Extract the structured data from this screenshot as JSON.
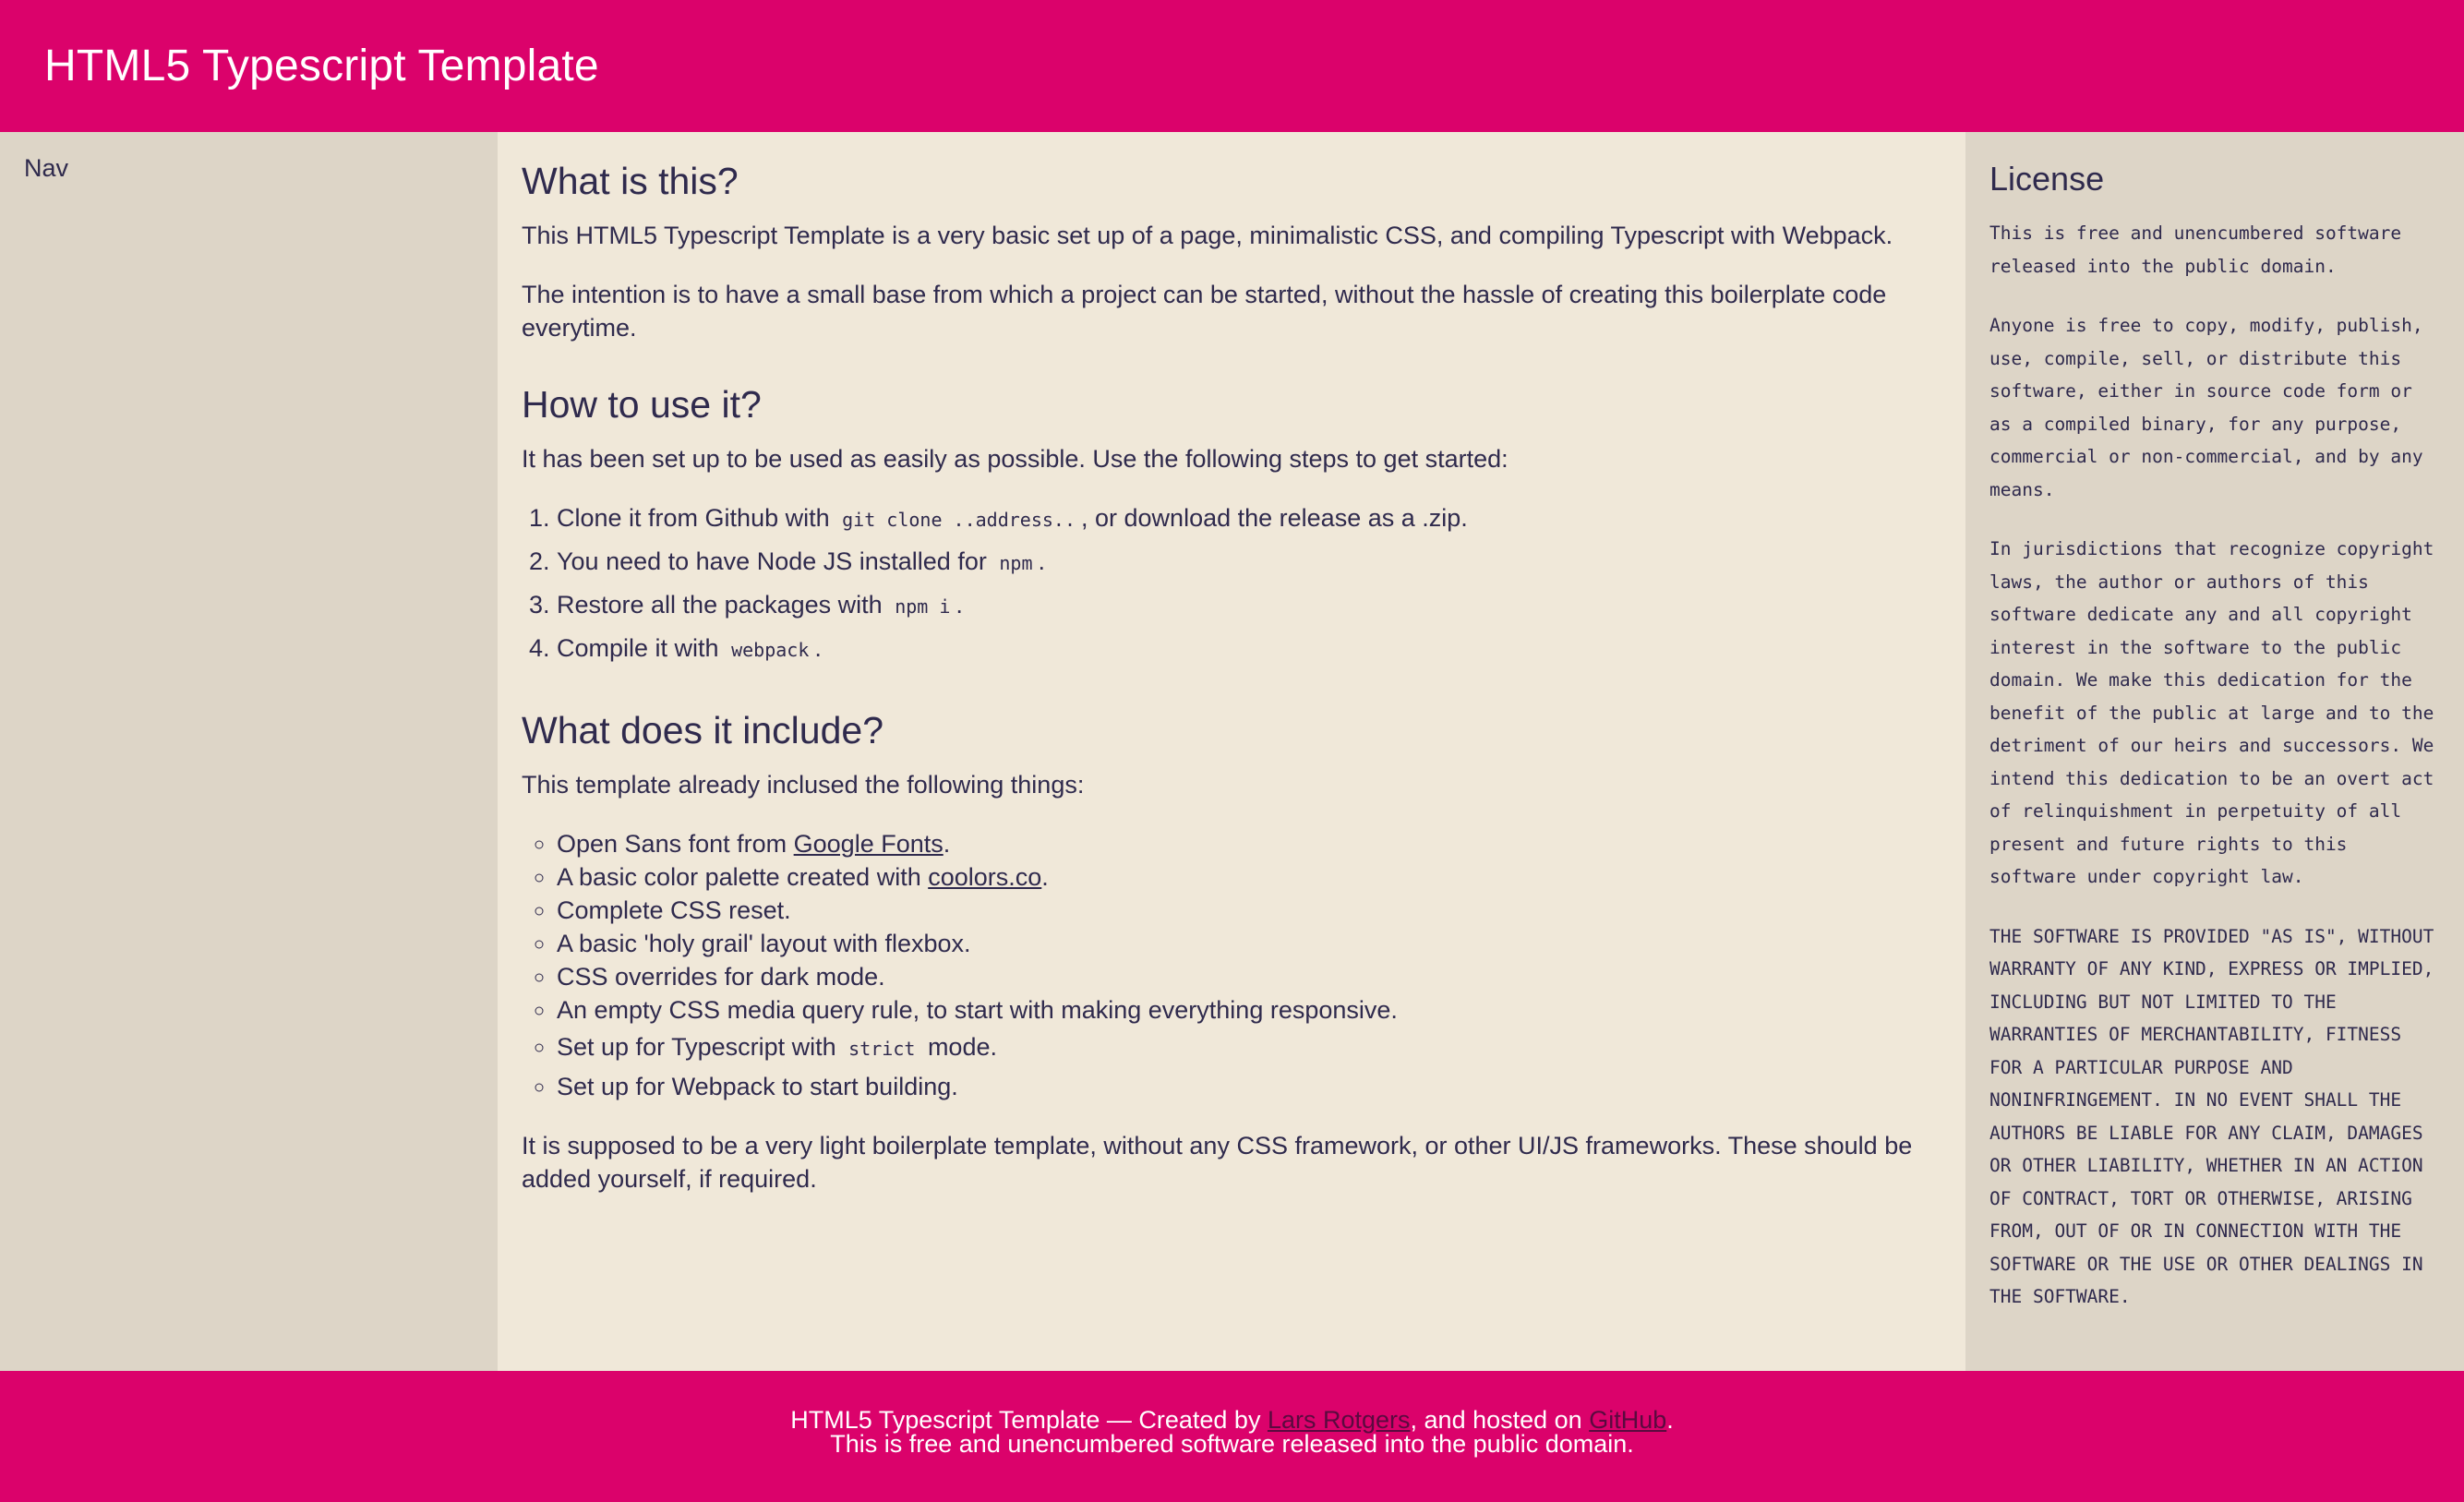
{
  "colors": {
    "brand": "#db026b",
    "background": "#f0e8d9",
    "sidebar": "#ddd5c7",
    "text": "#2f2a4d"
  },
  "header": {
    "title": "HTML5 Typescript Template"
  },
  "nav": {
    "label": "Nav"
  },
  "main": {
    "what": {
      "heading": "What is this?",
      "p1": "This HTML5 Typescript Template is a very basic set up of a page, minimalistic CSS, and compiling Typescript with Webpack.",
      "p2": "The intention is to have a small base from which a project can be started, without the hassle of creating this boilerplate code everytime."
    },
    "how": {
      "heading": "How to use it?",
      "intro": "It has been set up to be used as easily as possible. Use the following steps to get started:",
      "steps": [
        {
          "before": "Clone it from Github with",
          "code": "git clone ..address..",
          "after": ", or download the release as a .zip."
        },
        {
          "before": "You need to have Node JS installed for",
          "code": "npm",
          "after": "."
        },
        {
          "before": "Restore all the packages with",
          "code": "npm i",
          "after": "."
        },
        {
          "before": "Compile it with",
          "code": "webpack",
          "after": "."
        }
      ]
    },
    "include": {
      "heading": "What does it include?",
      "intro": "This template already inclused the following things:",
      "items": {
        "fonts": {
          "before": "Open Sans font from ",
          "link": "Google Fonts",
          "after": "."
        },
        "palette": {
          "before": "A basic color palette created with ",
          "link": "coolors.co",
          "after": "."
        },
        "reset": "Complete CSS reset.",
        "layout": "A basic 'holy grail' layout with flexbox.",
        "dark": "CSS overrides for dark mode.",
        "media": "An empty CSS media query rule, to start with making everything responsive.",
        "typescript": {
          "before": "Set up for Typescript with",
          "code": "strict",
          "after": "mode."
        },
        "webpack": "Set up for Webpack to start building."
      },
      "outro": "It is supposed to be a very light boilerplate template, without any CSS framework, or other UI/JS frameworks. These should be added yourself, if required."
    }
  },
  "license": {
    "heading": "License",
    "paragraphs": [
      "This is free and unencumbered software released into the public domain.",
      "Anyone is free to copy, modify, publish, use, compile, sell, or distribute this software, either in source code form or as a compiled binary, for any purpose, commercial or non-commercial, and by any means.",
      "In jurisdictions that recognize copyright laws, the author or authors of this software dedicate any and all copyright interest in the software to the public domain. We make this dedication for the benefit of the public at large and to the detriment of our heirs and successors. We intend this dedication to be an overt act of relinquishment in perpetuity of all present and future rights to this software under copyright law.",
      "THE SOFTWARE IS PROVIDED \"AS IS\", WITHOUT WARRANTY OF ANY KIND, EXPRESS OR IMPLIED, INCLUDING BUT NOT LIMITED TO THE WARRANTIES OF MERCHANTABILITY, FITNESS FOR A PARTICULAR PURPOSE AND NONINFRINGEMENT. IN NO EVENT SHALL THE AUTHORS BE LIABLE FOR ANY CLAIM, DAMAGES OR OTHER LIABILITY, WHETHER IN AN ACTION OF CONTRACT, TORT OR OTHERWISE, ARISING FROM, OUT OF OR IN CONNECTION WITH THE SOFTWARE OR THE USE OR OTHER DEALINGS IN THE SOFTWARE."
    ]
  },
  "footer": {
    "line1_before": "HTML5 Typescript Template — Created by ",
    "author_link": "Lars Rotgers",
    "line1_middle": ", and hosted on ",
    "github_link": "GitHub",
    "line1_after": ".",
    "line2": "This is free and unencumbered software released into the public domain."
  }
}
